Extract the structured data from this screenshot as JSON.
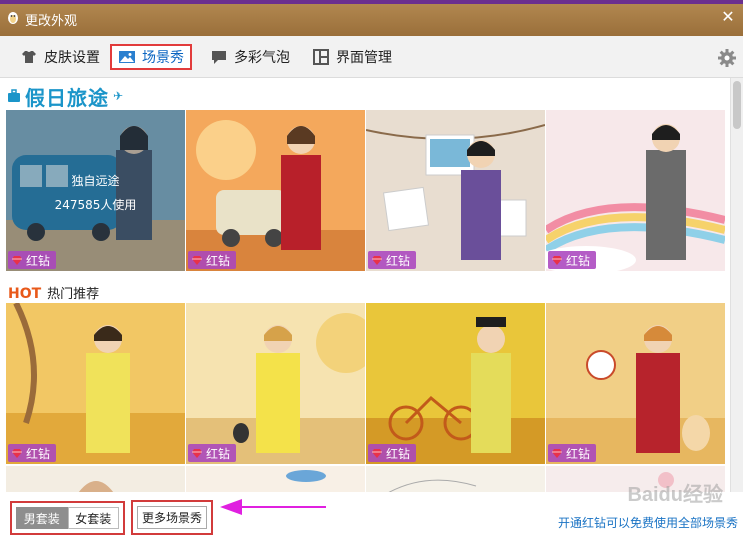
{
  "window": {
    "title": "更改外观",
    "close_glyph": "✕"
  },
  "tabs": [
    {
      "label": "皮肤设置",
      "icon": "tshirt-icon",
      "active": false
    },
    {
      "label": "场景秀",
      "icon": "picture-icon",
      "active": true
    },
    {
      "label": "多彩气泡",
      "icon": "speech-bubble-icon",
      "active": false
    },
    {
      "label": "界面管理",
      "icon": "layout-icon",
      "active": false
    }
  ],
  "sections": {
    "holiday_banner": "假日旅途",
    "hot_badge": "HOT",
    "hot_label": "热门推荐"
  },
  "row1": [
    {
      "badge": "红钻",
      "selected": true,
      "name": "独自远途",
      "users": "247585人使用"
    },
    {
      "badge": "红钻"
    },
    {
      "badge": "红钻"
    },
    {
      "badge": "红钻"
    }
  ],
  "row2": [
    {
      "badge": "红钻"
    },
    {
      "badge": "红钻"
    },
    {
      "badge": "红钻"
    },
    {
      "badge": "红钻"
    }
  ],
  "footer": {
    "gender_male": "男套装",
    "gender_female": "女套装",
    "more_button": "更多场景秀",
    "vip_link": "开通红钻可以免费使用全部场景秀",
    "watermark": "Baidu经验"
  },
  "colors": {
    "title_bar": "#a87c45",
    "active_tab_text": "#0b65c2",
    "highlight_border": "#d23b3b",
    "badge_bg": "#aa46be",
    "link": "#1a73c4",
    "arrow": "#e020e0",
    "hot": "#e8591a"
  }
}
